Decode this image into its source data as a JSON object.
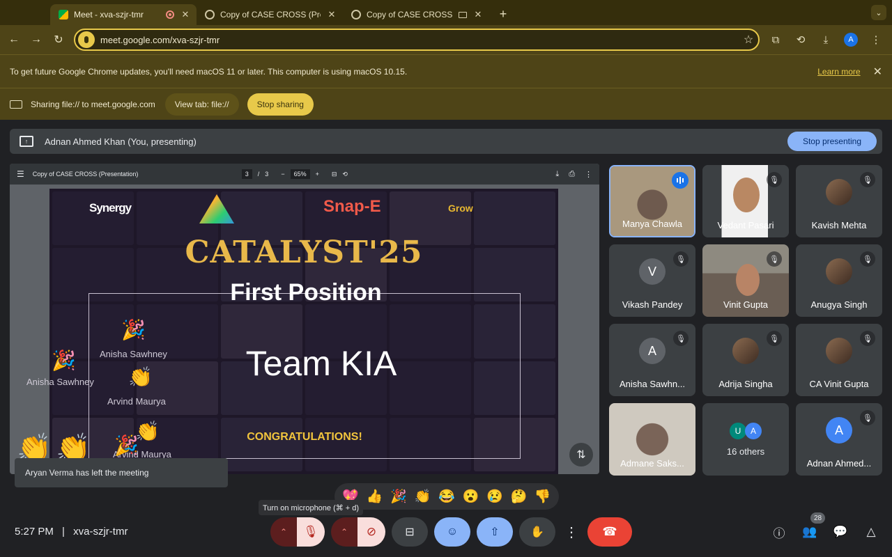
{
  "browser": {
    "tabs": [
      {
        "title": "Meet - xva-szjr-tmr",
        "active": true
      },
      {
        "title": "Copy of CASE CROSS (Presen",
        "active": false
      },
      {
        "title": "Copy of CASE CROSS (Pr",
        "active": false
      }
    ],
    "url": "meet.google.com/xva-szjr-tmr",
    "profile_initial": "A"
  },
  "update_bar": {
    "message": "To get future Google Chrome updates, you'll need macOS 11 or later. This computer is using macOS 10.15.",
    "link": "Learn more"
  },
  "share_bar": {
    "text": "Sharing file:// to meet.google.com",
    "view_tab": "View tab: file://",
    "stop_sharing": "Stop sharing"
  },
  "presenting_bar": {
    "text": "Adnan Ahmed Khan (You, presenting)",
    "stop_presenting": "Stop presenting"
  },
  "pdf_viewer": {
    "title": "Copy of CASE CROSS (Presentation)",
    "page": "3",
    "page_sep": "/",
    "total": "3",
    "zoom": "65%"
  },
  "slide": {
    "logos": [
      "Synergy",
      "The IMPACT Project",
      "Snap-E",
      "Grow"
    ],
    "heading": "CATALYST'25",
    "subheading": "First Position",
    "team": "Team KIA",
    "congrats": "CONGRATULATIONS!",
    "floating_names": [
      "Anisha Sawhney",
      "Anisha Sawhney",
      "Arvind Maurya",
      "Arvind Maurya"
    ]
  },
  "participants": [
    {
      "name": "Manya Chawla",
      "type": "video",
      "speaking": true
    },
    {
      "name": "Vedant Pasari",
      "type": "video",
      "muted": true
    },
    {
      "name": "Kavish Mehta",
      "type": "photo",
      "muted": true
    },
    {
      "name": "Vikash Pandey",
      "type": "initial",
      "initial": "V",
      "muted": true
    },
    {
      "name": "Vinit Gupta",
      "type": "video",
      "muted": true
    },
    {
      "name": "Anugya Singh",
      "type": "photo",
      "muted": true
    },
    {
      "name": "Anisha Sawhn...",
      "type": "initial",
      "initial": "A",
      "muted": true
    },
    {
      "name": "Adrija Singha",
      "type": "photo",
      "muted": true
    },
    {
      "name": "CA Vinit Gupta",
      "type": "photo",
      "muted": true
    },
    {
      "name": "Admane Saks...",
      "type": "video"
    },
    {
      "name": "16 others",
      "type": "others",
      "initials": [
        "U",
        "A"
      ]
    },
    {
      "name": "Adnan Ahmed...",
      "type": "initial",
      "initial": "A",
      "muted": true
    }
  ],
  "toast": "Aryan Verma has left the meeting",
  "tooltip": "Turn on microphone (⌘ + d)",
  "reactions": [
    "💖",
    "👍",
    "🎉",
    "👏",
    "😂",
    "😮",
    "😢",
    "🤔",
    "👎"
  ],
  "footer": {
    "time": "5:27 PM",
    "separator": "|",
    "meeting_code": "xva-szjr-tmr",
    "people_count": "28"
  }
}
